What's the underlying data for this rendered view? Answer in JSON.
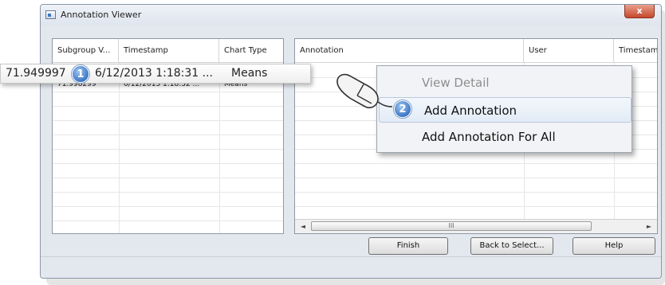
{
  "window": {
    "title": "Annotation Viewer",
    "close_label": "x"
  },
  "left_table": {
    "headers": [
      "Subgroup V...",
      "Timestamp",
      "Chart Type"
    ],
    "rows": [
      [
        "71.949997",
        "6/12/2013 1:18:31 ...",
        "Means"
      ],
      [
        "71.998299",
        "6/12/2013 1:18:32 ...",
        "Means"
      ]
    ]
  },
  "right_table": {
    "headers": [
      "Annotation",
      "User",
      "Timestam"
    ],
    "scroll_label": "III"
  },
  "callout": {
    "value": "71.949997",
    "badge": "1",
    "timestamp": "6/12/2013 1:18:31 ...",
    "chart_type": "Means"
  },
  "context_menu": {
    "badge": "2",
    "items": [
      {
        "label": "View Detail",
        "disabled": true
      },
      {
        "label": "Add Annotation",
        "disabled": false
      },
      {
        "label": "Add Annotation For All",
        "disabled": false
      }
    ]
  },
  "buttons": {
    "finish": "Finish",
    "back": "Back to Select...",
    "help": "Help"
  },
  "colors": {
    "badge": "#3d77c4",
    "close": "#c7472c",
    "accent": "#3f78c0"
  },
  "icons": {
    "close": "close-icon",
    "app": "app-icon",
    "mouse": "mouse-icon",
    "scroll_left": "arrow-left-icon",
    "scroll_right": "arrow-right-icon"
  }
}
